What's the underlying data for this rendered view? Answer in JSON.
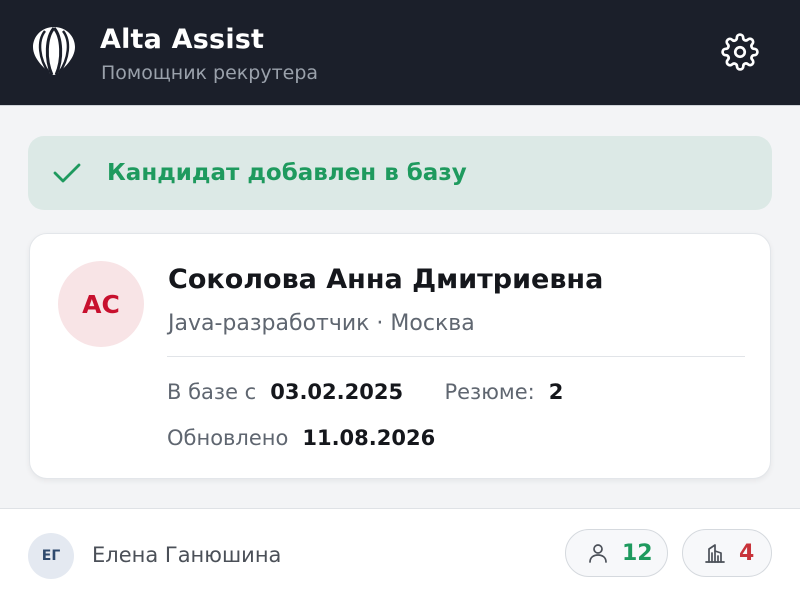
{
  "header": {
    "title": "Alta Assist",
    "subtitle": "Помощник рекрутера",
    "logo_icon": "hot-air-balloon-icon",
    "settings_icon": "gear-icon"
  },
  "banner": {
    "text": "Кандидат добавлен в базу",
    "icon": "check-icon",
    "color": "#1e9a5e"
  },
  "candidate": {
    "initials": "АС",
    "name": "Соколова Анна Дмитриевна",
    "role_location": "Java-разработчик · Москва",
    "in_base_label": "В базе с",
    "in_base_value": "03.02.2025",
    "resumes_label": "Резюме:",
    "resumes_value": "2",
    "updated_label": "Обновлено",
    "updated_value": "11.08.2026"
  },
  "footer": {
    "user_initials": "ЕГ",
    "user_name": "Елена Ганюшина",
    "candidates_icon": "person-icon",
    "candidates_count": "12",
    "companies_icon": "building-icon",
    "companies_count": "4"
  },
  "colors": {
    "brand_red": "#c8102e",
    "header_bg": "#1b1f2a",
    "success": "#1e9a5e",
    "danger": "#c8333a"
  }
}
